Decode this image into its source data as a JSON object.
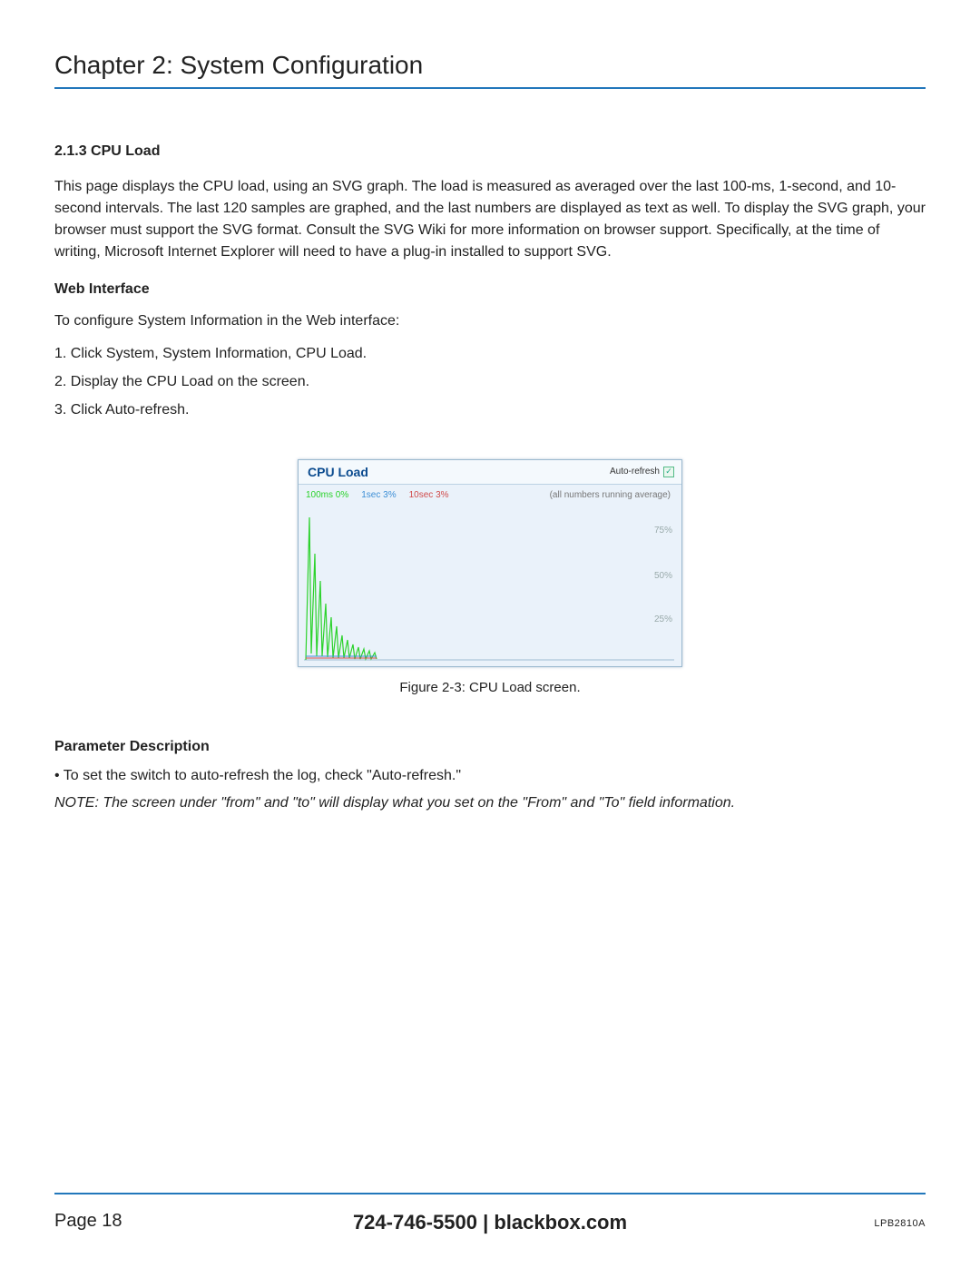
{
  "chapterTitle": "Chapter 2: System Configuration",
  "sectionNumber": "2.1.3 CPU Load",
  "intro": "This page displays the CPU load, using an SVG graph. The load is measured as averaged over the last 100-ms, 1-second, and 10-second intervals. The last 120 samples are graphed, and the last numbers are displayed as text as well. To display the SVG graph, your browser must support the SVG format. Consult the SVG Wiki for more information on browser support. Specifically, at the time of writing, Microsoft Internet Explorer will need to have a plug-in installed to support SVG.",
  "webInterfaceHeading": "Web Interface",
  "webInterfaceLead": "To configure System Information in the Web interface:",
  "steps": [
    "1. Click System, System Information, CPU Load.",
    "2. Display the CPU Load on the screen.",
    "3. Click Auto-refresh."
  ],
  "cpuLoad": {
    "title": "CPU Load",
    "autoRefreshLabel": "Auto-refresh",
    "autoRefreshChecked": true,
    "legend": {
      "s100ms": "100ms 0%",
      "s1sec": "1sec 3%",
      "s10sec": "10sec 3%",
      "note": "(all numbers running average)"
    },
    "gridLabels": {
      "g75": "75%",
      "g50": "50%",
      "g25": "25%"
    }
  },
  "figureCaption": "Figure 2-3: CPU Load screen.",
  "paramHeading": "Parameter Description",
  "paramBullet": "• To set the switch to auto-refresh the log, check \"Auto-refresh.\"",
  "noteText": "NOTE: The screen under \"from\" and \"to\" will display what you set on the \"From\" and \"To\" field information.",
  "footer": {
    "page": "Page 18",
    "phone": "724-746-5500",
    "sep": "   |   ",
    "site": "blackbox.com",
    "model": "LPB2810A"
  },
  "chart_data": {
    "type": "line",
    "title": "CPU Load",
    "xlabel": "",
    "ylabel": "",
    "ylim": [
      0,
      100
    ],
    "grid_y": [
      25,
      50,
      75
    ],
    "note": "(all numbers running average)",
    "series": [
      {
        "name": "100ms",
        "current_label": "100ms 0%",
        "color": "#2bd22b",
        "x": [
          0,
          1,
          2,
          3,
          4,
          5,
          6,
          7,
          8,
          9,
          10,
          11,
          12,
          13,
          14,
          15,
          16,
          17,
          18,
          19,
          20,
          21,
          22,
          23,
          24
        ],
        "values": [
          0,
          95,
          5,
          70,
          3,
          50,
          4,
          35,
          3,
          25,
          2,
          20,
          2,
          15,
          2,
          12,
          2,
          10,
          2,
          8,
          2,
          6,
          2,
          5,
          0
        ]
      },
      {
        "name": "1sec",
        "current_label": "1sec 3%",
        "color": "#3d8fd6",
        "x": [
          0,
          1,
          2,
          3,
          4,
          5,
          6,
          7,
          8,
          9,
          10,
          11,
          12,
          13,
          14,
          15,
          16,
          17,
          18,
          19,
          20,
          21,
          22,
          23,
          24
        ],
        "values": [
          3,
          3,
          3,
          3,
          3,
          3,
          3,
          3,
          3,
          3,
          3,
          3,
          3,
          3,
          3,
          3,
          3,
          3,
          3,
          3,
          3,
          3,
          3,
          3,
          3
        ]
      },
      {
        "name": "10sec",
        "current_label": "10sec 3%",
        "color": "#d04a4a",
        "x": [
          0,
          1,
          2,
          3,
          4,
          5,
          6,
          7,
          8,
          9,
          10,
          11,
          12,
          13,
          14,
          15,
          16,
          17,
          18,
          19,
          20,
          21,
          22,
          23,
          24
        ],
        "values": [
          3,
          3,
          3,
          3,
          3,
          3,
          3,
          3,
          3,
          3,
          3,
          3,
          3,
          3,
          3,
          3,
          3,
          3,
          3,
          3,
          3,
          3,
          3,
          3,
          3
        ]
      }
    ]
  }
}
